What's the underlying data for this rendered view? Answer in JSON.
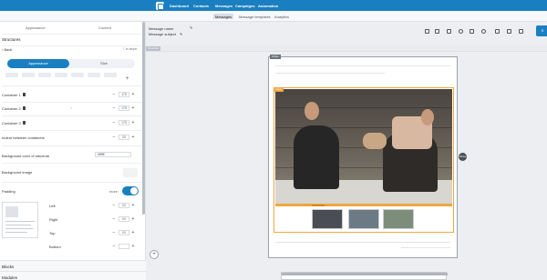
{
  "nav": {
    "items": [
      "Dashboard",
      "Contacts",
      "Messages",
      "Campaigns",
      "Automation"
    ]
  },
  "subnav": {
    "tabs": [
      "Messages",
      "Message templates",
      "Analytics"
    ],
    "active": "Messages"
  },
  "left_panel": {
    "tabs": [
      "Appearance",
      "Content"
    ],
    "section_title": "Structures",
    "back_label": "Back",
    "to_stripe_label": "to stripe",
    "segment": {
      "active": "Appearance",
      "inactive": "Size"
    },
    "containers": [
      {
        "label": "Container 1",
        "value": "175"
      },
      {
        "label": "Container 2",
        "value": "175"
      },
      {
        "label": "Container 3",
        "value": "175"
      }
    ],
    "indent_label": "Indent between containers",
    "indent_value": "20",
    "bg_color_label": "Background color of structure",
    "bg_color_value": "#ffffff",
    "bg_image_label": "Background image",
    "padding_label": "Padding",
    "padding_mode": "more",
    "padding_sides": [
      {
        "label": "Left",
        "value": "20"
      },
      {
        "label": "Right",
        "value": "20"
      },
      {
        "label": "Top",
        "value": "20"
      },
      {
        "label": "Bottom",
        "value": ""
      }
    ],
    "blocks_label": "Blocks",
    "modules_label": "Modules"
  },
  "header": {
    "message_name_label": "Message name",
    "message_subject_label": "Message subject",
    "send_label": "S"
  },
  "canvas": {
    "chip_label": "Structure",
    "email_tag": "Stripe",
    "hero_tag": "Image",
    "side_handle": "Stripe"
  },
  "icons": [
    "edit-icon",
    "undo-icon",
    "redo-icon",
    "mobile-icon",
    "code-icon",
    "settings-icon",
    "eye-icon",
    "copy-icon"
  ],
  "colors": {
    "brand": "#1a7fc1",
    "selection": "#f0a640"
  }
}
